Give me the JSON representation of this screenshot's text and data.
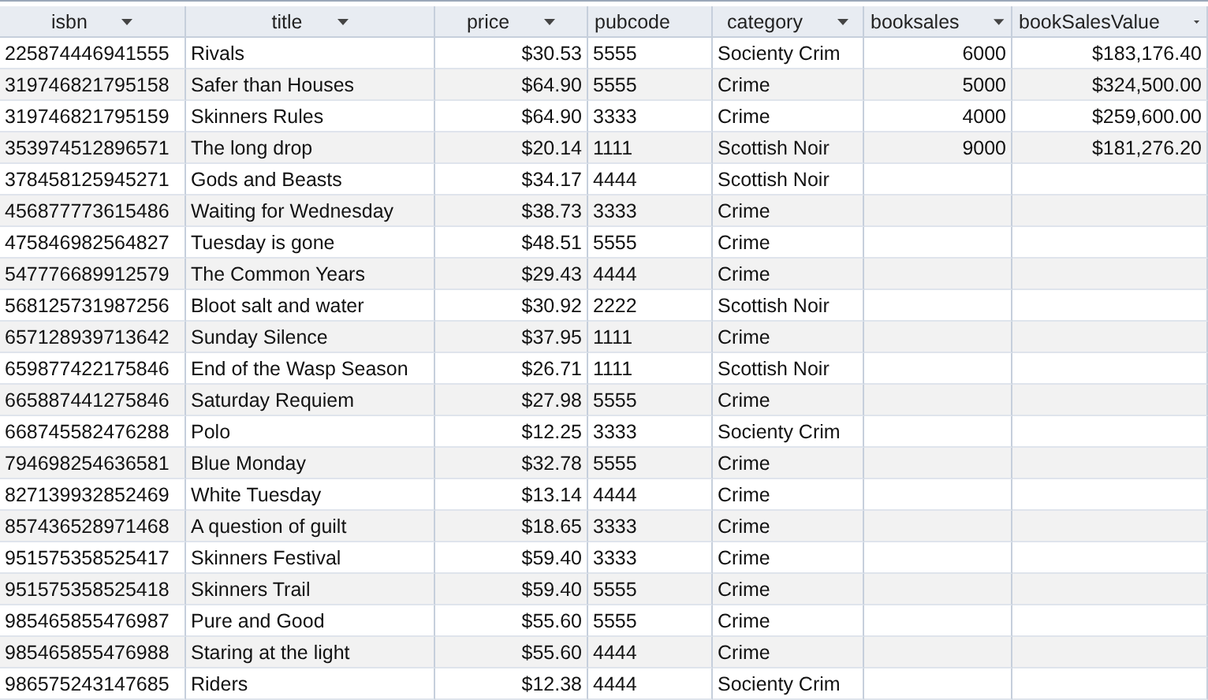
{
  "table": {
    "columns": [
      {
        "label": "isbn",
        "kind": "text"
      },
      {
        "label": "title",
        "kind": "text"
      },
      {
        "label": "price",
        "kind": "number"
      },
      {
        "label": "pubcode",
        "kind": "text"
      },
      {
        "label": "category",
        "kind": "text"
      },
      {
        "label": "booksales",
        "kind": "number"
      },
      {
        "label": "bookSalesValue",
        "kind": "number"
      }
    ],
    "rows": [
      {
        "cells": [
          "225874446941555",
          "Rivals",
          "$30.53",
          "5555",
          "Socienty Crim",
          "6000",
          "$183,176.40"
        ]
      },
      {
        "cells": [
          "319746821795158",
          "Safer than Houses",
          "$64.90",
          "5555",
          "Crime",
          "5000",
          "$324,500.00"
        ]
      },
      {
        "cells": [
          "319746821795159",
          "Skinners Rules",
          "$64.90",
          "3333",
          "Crime",
          "4000",
          "$259,600.00"
        ]
      },
      {
        "cells": [
          "353974512896571",
          "The long drop",
          "$20.14",
          "1111",
          "Scottish Noir",
          "9000",
          "$181,276.20"
        ]
      },
      {
        "cells": [
          "378458125945271",
          "Gods and Beasts",
          "$34.17",
          "4444",
          "Scottish Noir"
        ]
      },
      {
        "cells": [
          "456877773615486",
          "Waiting for Wednesday",
          "$38.73",
          "3333",
          "Crime"
        ]
      },
      {
        "cells": [
          "475846982564827",
          "Tuesday is gone",
          "$48.51",
          "5555",
          "Crime"
        ]
      },
      {
        "cells": [
          "547776689912579",
          "The Common Years",
          "$29.43",
          "4444",
          "Crime"
        ]
      },
      {
        "cells": [
          "568125731987256",
          "Bloot salt and water",
          "$30.92",
          "2222",
          "Scottish Noir"
        ]
      },
      {
        "cells": [
          "657128939713642",
          "Sunday Silence",
          "$37.95",
          "1111",
          "Crime"
        ]
      },
      {
        "cells": [
          "659877422175846",
          "End of the Wasp Season",
          "$26.71",
          "1111",
          "Scottish Noir"
        ]
      },
      {
        "cells": [
          "665887441275846",
          "Saturday Requiem",
          "$27.98",
          "5555",
          "Crime"
        ]
      },
      {
        "cells": [
          "668745582476288",
          "Polo",
          "$12.25",
          "3333",
          "Socienty Crim"
        ]
      },
      {
        "cells": [
          "794698254636581",
          "Blue Monday",
          "$32.78",
          "5555",
          "Crime"
        ]
      },
      {
        "cells": [
          "827139932852469",
          "White Tuesday",
          "$13.14",
          "4444",
          "Crime"
        ]
      },
      {
        "cells": [
          "857436528971468",
          "A question of guilt",
          "$18.65",
          "3333",
          "Crime"
        ]
      },
      {
        "cells": [
          "951575358525417",
          "Skinners Festival",
          "$59.40",
          "3333",
          "Crime"
        ]
      },
      {
        "cells": [
          "951575358525418",
          "Skinners Trail",
          "$59.40",
          "5555",
          "Crime"
        ]
      },
      {
        "cells": [
          "985465855476987",
          "Pure and Good",
          "$55.60",
          "5555",
          "Crime"
        ]
      },
      {
        "cells": [
          "985465855476988",
          "Staring at the light",
          "$55.60",
          "4444",
          "Crime"
        ]
      },
      {
        "cells": [
          "986575243147685",
          "Riders",
          "$12.38",
          "4444",
          "Socienty Crim"
        ]
      }
    ]
  }
}
